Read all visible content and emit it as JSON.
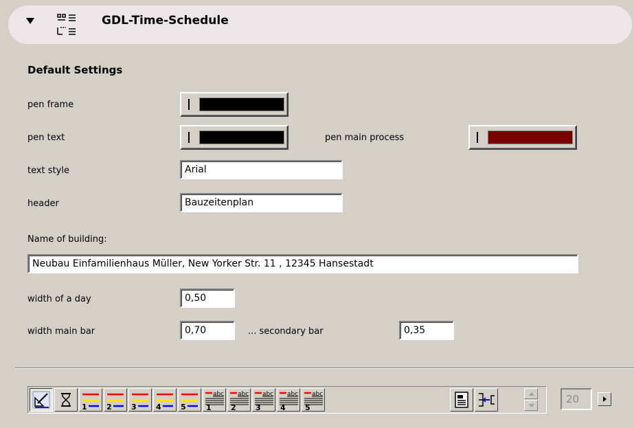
{
  "header": {
    "title": "GDL-Time-Schedule"
  },
  "section": {
    "title": "Default Settings"
  },
  "fields": {
    "pen_frame_label": "pen frame",
    "pen_text_label": "pen text",
    "pen_main_process_label": "pen main process",
    "text_style_label": "text style",
    "text_style_value": "Arial",
    "header_label": "header",
    "header_value": "Bauzeitenplan",
    "building_label": "Name of building:",
    "building_value": "Neubau Einfamilienhaus Müller, New Yorker Str. 11 , 12345 Hansestadt",
    "day_width_label": "width of a day",
    "day_width_value": "0,50",
    "main_bar_label": "width main bar",
    "main_bar_value": "0,70",
    "secondary_bar_label": "... secondary bar",
    "secondary_bar_value": "0,35"
  },
  "colors": {
    "pen_frame": "#000000",
    "pen_text": "#000000",
    "pen_main_process": "#7a0000"
  },
  "toolbar": {
    "bar_numbers": [
      "1",
      "2",
      "3",
      "4",
      "5"
    ],
    "abc_label": "abc",
    "abc_numbers": [
      "1",
      "2",
      "3",
      "4",
      "5"
    ],
    "page_value": "20"
  }
}
